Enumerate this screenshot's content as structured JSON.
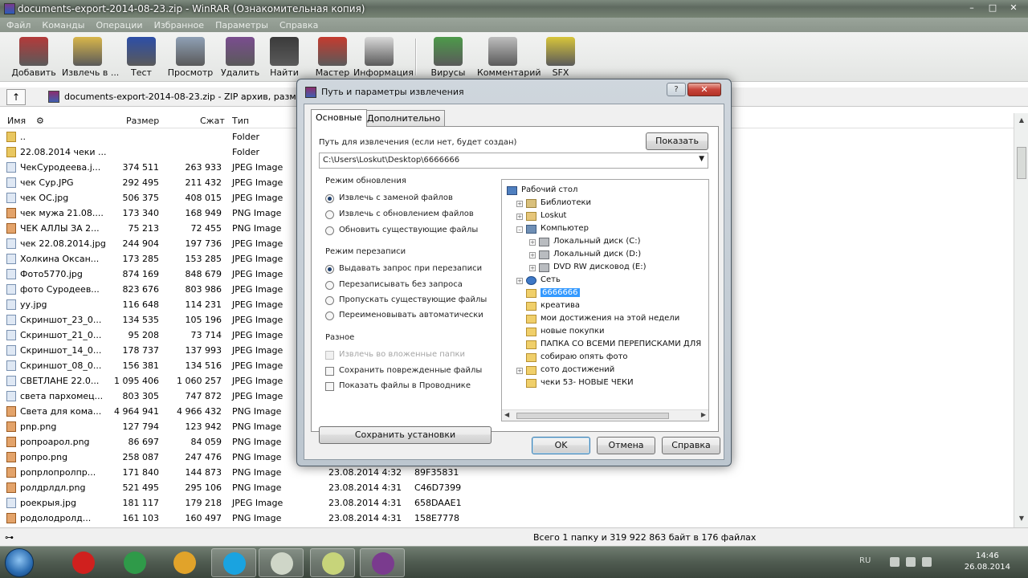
{
  "window": {
    "title": "documents-export-2014-08-23.zip - WinRAR (Ознакомительная копия)",
    "controls": [
      "–",
      "□",
      "✕"
    ]
  },
  "menu": [
    "Файл",
    "Команды",
    "Операции",
    "Избранное",
    "Параметры",
    "Справка"
  ],
  "toolbar": [
    {
      "label": "Добавить",
      "icon": "add-archive-icon",
      "color": "#b43a3a"
    },
    {
      "label": "Извлечь в ...",
      "icon": "extract-folder-icon",
      "color": "#d9b64a"
    },
    {
      "label": "Тест",
      "icon": "test-book-icon",
      "color": "#2d4ea7"
    },
    {
      "label": "Просмотр",
      "icon": "view-glasses-icon",
      "color": "#8fa0b5"
    },
    {
      "label": "Удалить",
      "icon": "delete-icon",
      "color": "#7a4d8f"
    },
    {
      "label": "Найти",
      "icon": "find-binoculars-icon",
      "color": "#3b3b3b"
    },
    {
      "label": "Мастер",
      "icon": "wizard-icon",
      "color": "#c53b2f"
    },
    {
      "label": "Информация",
      "icon": "info-icon",
      "color": "#d9d9d9"
    },
    {
      "label": "Вирусы",
      "icon": "virus-scan-icon",
      "color": "#4d9a4a"
    },
    {
      "label": "Комментарий",
      "icon": "comment-pen-icon",
      "color": "#bdbdbd"
    },
    {
      "label": "SFX",
      "icon": "sfx-icon",
      "color": "#d8c53a"
    }
  ],
  "address": {
    "up": "↑",
    "path": "documents-export-2014-08-23.zip - ZIP архив, размер"
  },
  "columns": {
    "name": "Имя",
    "size": "Размер",
    "packed": "Сжат",
    "type": "Тип"
  },
  "files": [
    {
      "name": "..",
      "size": "",
      "packed": "",
      "type": "Folder",
      "mod": "",
      "crc": "",
      "kind": "folder"
    },
    {
      "name": "22.08.2014 чеки ...",
      "size": "",
      "packed": "",
      "type": "Folder",
      "mod": "",
      "crc": "",
      "kind": "folder"
    },
    {
      "name": "ЧекСуродеева.j...",
      "size": "374 511",
      "packed": "263 933",
      "type": "JPEG Image",
      "mod": "",
      "crc": "",
      "kind": "jpg"
    },
    {
      "name": "чек Сур.JPG",
      "size": "292 495",
      "packed": "211 432",
      "type": "JPEG Image",
      "mod": "",
      "crc": "",
      "kind": "jpg"
    },
    {
      "name": "чек ОС.jpg",
      "size": "506 375",
      "packed": "408 015",
      "type": "JPEG Image",
      "mod": "",
      "crc": "",
      "kind": "jpg"
    },
    {
      "name": "чек мужа 21.08....",
      "size": "173 340",
      "packed": "168 949",
      "type": "PNG Image",
      "mod": "",
      "crc": "",
      "kind": "png"
    },
    {
      "name": "ЧЕК АЛЛЫ ЗА 2...",
      "size": "75 213",
      "packed": "72 455",
      "type": "PNG Image",
      "mod": "",
      "crc": "",
      "kind": "png"
    },
    {
      "name": "чек 22.08.2014.jpg",
      "size": "244 904",
      "packed": "197 736",
      "type": "JPEG Image",
      "mod": "",
      "crc": "",
      "kind": "jpg"
    },
    {
      "name": "Холкина Оксан...",
      "size": "173 285",
      "packed": "153 285",
      "type": "JPEG Image",
      "mod": "",
      "crc": "",
      "kind": "jpg"
    },
    {
      "name": "Фото5770.jpg",
      "size": "874 169",
      "packed": "848 679",
      "type": "JPEG Image",
      "mod": "",
      "crc": "",
      "kind": "jpg"
    },
    {
      "name": "фото Суродеев...",
      "size": "823 676",
      "packed": "803 986",
      "type": "JPEG Image",
      "mod": "",
      "crc": "",
      "kind": "jpg"
    },
    {
      "name": "уу.jpg",
      "size": "116 648",
      "packed": "114 231",
      "type": "JPEG Image",
      "mod": "",
      "crc": "",
      "kind": "jpg"
    },
    {
      "name": "Скриншот_23_0...",
      "size": "134 535",
      "packed": "105 196",
      "type": "JPEG Image",
      "mod": "",
      "crc": "",
      "kind": "jpg"
    },
    {
      "name": "Скриншот_21_0...",
      "size": "95 208",
      "packed": "73 714",
      "type": "JPEG Image",
      "mod": "",
      "crc": "",
      "kind": "jpg"
    },
    {
      "name": "Скриншот_14_0...",
      "size": "178 737",
      "packed": "137 993",
      "type": "JPEG Image",
      "mod": "",
      "crc": "",
      "kind": "jpg"
    },
    {
      "name": "Скриншот_08_0...",
      "size": "156 381",
      "packed": "134 516",
      "type": "JPEG Image",
      "mod": "",
      "crc": "",
      "kind": "jpg"
    },
    {
      "name": "СВЕТЛАНЕ 22.0...",
      "size": "1 095 406",
      "packed": "1 060 257",
      "type": "JPEG Image",
      "mod": "",
      "crc": "",
      "kind": "jpg"
    },
    {
      "name": "света пархомец...",
      "size": "803 305",
      "packed": "747 872",
      "type": "JPEG Image",
      "mod": "",
      "crc": "",
      "kind": "jpg"
    },
    {
      "name": "Света для кома...",
      "size": "4 964 941",
      "packed": "4 966 432",
      "type": "PNG Image",
      "mod": "",
      "crc": "",
      "kind": "png"
    },
    {
      "name": "pnp.png",
      "size": "127 794",
      "packed": "123 942",
      "type": "PNG Image",
      "mod": "",
      "crc": "",
      "kind": "png"
    },
    {
      "name": "ропроарол.png",
      "size": "86 697",
      "packed": "84 059",
      "type": "PNG Image",
      "mod": "",
      "crc": "",
      "kind": "png"
    },
    {
      "name": "ропро.png",
      "size": "258 087",
      "packed": "247 476",
      "type": "PNG Image",
      "mod": "",
      "crc": "",
      "kind": "png"
    },
    {
      "name": "ропрлопролпр...",
      "size": "171 840",
      "packed": "144 873",
      "type": "PNG Image",
      "mod": "23.08.2014 4:32",
      "crc": "89F35831",
      "kind": "png"
    },
    {
      "name": "ролдрлдл.png",
      "size": "521 495",
      "packed": "295 106",
      "type": "PNG Image",
      "mod": "23.08.2014 4:31",
      "crc": "C46D7399",
      "kind": "png"
    },
    {
      "name": "роекрыя.jpg",
      "size": "181 117",
      "packed": "179 218",
      "type": "JPEG Image",
      "mod": "23.08.2014 4:31",
      "crc": "658DAAE1",
      "kind": "jpg"
    },
    {
      "name": "родолодролд...",
      "size": "161 103",
      "packed": "160 497",
      "type": "PNG Image",
      "mod": "23.08.2014 4:31",
      "crc": "158E7778",
      "kind": "png"
    }
  ],
  "status": {
    "left": "⊶",
    "summary": "Всего 1 папку и 319 922 863 байт в 176 файлах"
  },
  "taskbar": {
    "lang": "RU",
    "time": "14:46",
    "date": "26.08.2014",
    "apps": [
      {
        "name": "opera",
        "color": "#d0201e"
      },
      {
        "name": "chrome-window",
        "color": "#2f9a49"
      },
      {
        "name": "chrome",
        "color": "#e1a32a"
      },
      {
        "name": "skype",
        "color": "#1aa3e0"
      },
      {
        "name": "notes",
        "color": "#cfd6c8"
      },
      {
        "name": "folder",
        "color": "#c7d47a"
      },
      {
        "name": "winrar",
        "color": "#7a3b8e"
      }
    ]
  },
  "dialog": {
    "title": "Путь и параметры извлечения",
    "help_glyph": "?",
    "close_glyph": "✕",
    "tabs": [
      "Основные",
      "Дополнительно"
    ],
    "path_label": "Путь для извлечения (если нет, будет создан)",
    "show_button": "Показать",
    "path_value": "C:\\Users\\Loskut\\Desktop\\6666666",
    "update_mode": {
      "title": "Режим обновления",
      "options": [
        "Извлечь с заменой файлов",
        "Извлечь с обновлением файлов",
        "Обновить существующие файлы"
      ],
      "selected": 0
    },
    "overwrite_mode": {
      "title": "Режим перезаписи",
      "options": [
        "Выдавать запрос при перезаписи",
        "Перезаписывать без запроса",
        "Пропускать существующие файлы",
        "Переименовывать автоматически"
      ],
      "selected": 0
    },
    "misc": {
      "title": "Разное",
      "options": [
        "Извлечь во вложенные папки",
        "Сохранить поврежденные файлы",
        "Показать файлы в Проводнике"
      ]
    },
    "save_button": "Сохранить установки",
    "tree": [
      {
        "label": "Рабочий стол",
        "icon": "desktop-icon",
        "depth": 0,
        "expander": "",
        "kind": "desk"
      },
      {
        "label": "Библиотеки",
        "icon": "library-icon",
        "depth": 1,
        "expander": "+",
        "kind": "lib"
      },
      {
        "label": "Loskut",
        "icon": "user-folder-icon",
        "depth": 1,
        "expander": "+",
        "kind": "user"
      },
      {
        "label": "Компьютер",
        "icon": "computer-icon",
        "depth": 1,
        "expander": "–",
        "kind": "comp"
      },
      {
        "label": "Локальный диск (C:)",
        "icon": "hard-disk-icon",
        "depth": 2,
        "expander": "+",
        "kind": "disk"
      },
      {
        "label": "Локальный диск (D:)",
        "icon": "hard-disk-icon",
        "depth": 2,
        "expander": "+",
        "kind": "disk"
      },
      {
        "label": "DVD RW дисковод (E:)",
        "icon": "dvd-drive-icon",
        "depth": 2,
        "expander": "+",
        "kind": "disk"
      },
      {
        "label": "Сеть",
        "icon": "network-icon",
        "depth": 1,
        "expander": "+",
        "kind": "net"
      },
      {
        "label": "6666666",
        "icon": "folder-icon",
        "depth": 1,
        "expander": "",
        "kind": "fold",
        "selected": true
      },
      {
        "label": "креатива",
        "icon": "folder-icon",
        "depth": 1,
        "expander": "",
        "kind": "fold"
      },
      {
        "label": "мои достижения на этой недели",
        "icon": "folder-icon",
        "depth": 1,
        "expander": "",
        "kind": "fold"
      },
      {
        "label": "новые покупки",
        "icon": "folder-icon",
        "depth": 1,
        "expander": "",
        "kind": "fold"
      },
      {
        "label": "ПАПКА СО ВСЕМИ ПЕРЕПИСКАМИ ДЛЯ",
        "icon": "folder-icon",
        "depth": 1,
        "expander": "",
        "kind": "fold"
      },
      {
        "label": "собираю опять фото",
        "icon": "folder-icon",
        "depth": 1,
        "expander": "",
        "kind": "fold"
      },
      {
        "label": "сото достижений",
        "icon": "folder-icon",
        "depth": 1,
        "expander": "+",
        "kind": "fold"
      },
      {
        "label": "чеки 53- НОВЫЕ ЧЕКИ",
        "icon": "folder-icon",
        "depth": 1,
        "expander": "",
        "kind": "fold"
      }
    ],
    "ok": "OK",
    "cancel": "Отмена",
    "help": "Справка"
  }
}
